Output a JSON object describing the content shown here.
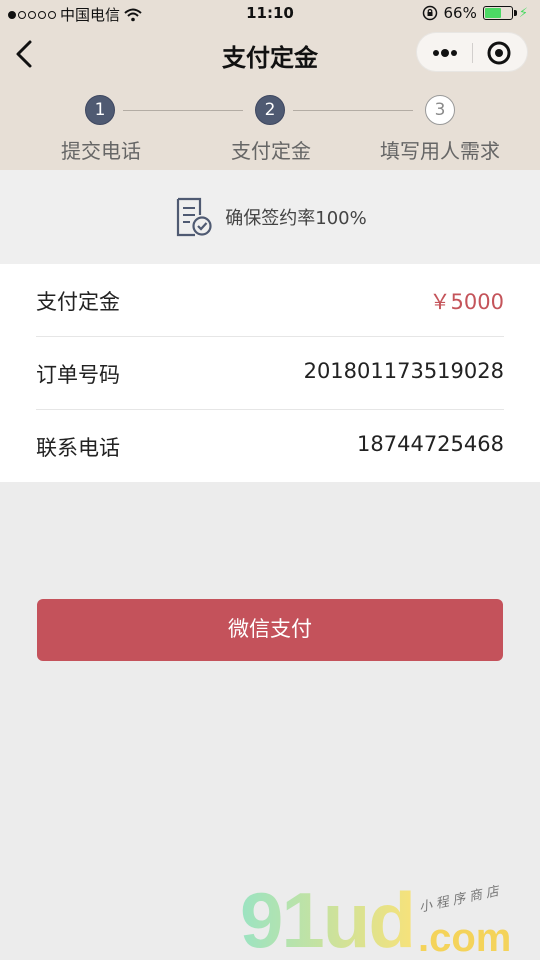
{
  "status_bar": {
    "carrier": "中国电信",
    "time": "11:10",
    "battery_percent": "66%",
    "battery_level": 0.66,
    "signal_bars_filled": 1,
    "signal_bars_total": 5
  },
  "nav": {
    "title": "支付定金",
    "back_icon": "chevron-left-icon",
    "more_icon": "more-dots-icon",
    "close_icon": "target-close-icon"
  },
  "steps": [
    {
      "number": "1",
      "label": "提交电话",
      "state": "done"
    },
    {
      "number": "2",
      "label": "支付定金",
      "state": "done"
    },
    {
      "number": "3",
      "label": "填写用人需求",
      "state": "todo"
    }
  ],
  "guarantee": {
    "icon": "document-check-icon",
    "text": "确保签约率100%"
  },
  "details": [
    {
      "label": "支付定金",
      "value": "￥5000",
      "accent": true
    },
    {
      "label": "订单号码",
      "value": "201801173519028",
      "accent": false
    },
    {
      "label": "联系电话",
      "value": "18744725468",
      "accent": false
    }
  ],
  "pay_button": {
    "label": "微信支付"
  },
  "watermark": {
    "brand": "91ud",
    "domain": ".com",
    "tagline": "小程序商店"
  },
  "colors": {
    "header_bg": "#e7dfd6",
    "step_active": "#4f5a72",
    "accent_red": "#c4525b",
    "amount_red": "#c4545a"
  }
}
